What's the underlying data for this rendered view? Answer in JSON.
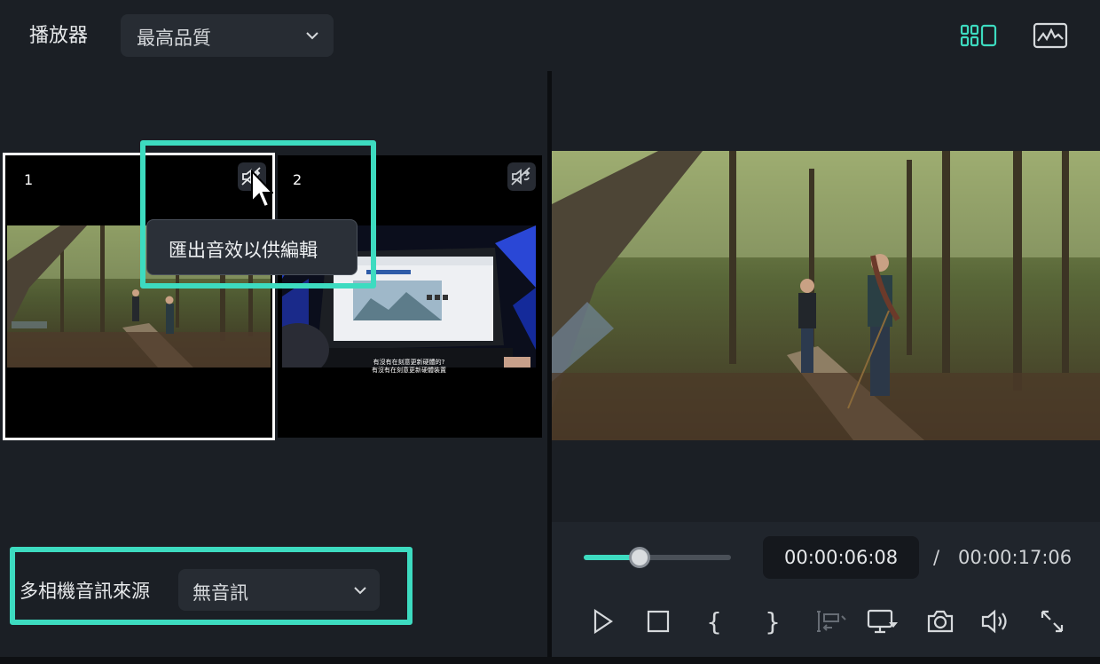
{
  "header": {
    "player_label": "播放器",
    "quality_value": "最高品質"
  },
  "cameras": [
    {
      "number": "1",
      "selected": true,
      "subtitle": []
    },
    {
      "number": "2",
      "selected": false,
      "subtitle": [
        "有沒有在刻意更新硬體的?",
        "有沒有在刻意更新硬體裝置"
      ]
    }
  ],
  "tooltip": {
    "text": "匯出音效以供編輯"
  },
  "audio_source": {
    "label": "多相機音訊來源",
    "value": "無音訊"
  },
  "playback": {
    "current_time": "00:00:06:08",
    "separator": "/",
    "total_time": "00:00:17:06",
    "progress": 0.38,
    "controls": {
      "brace_open": "{",
      "brace_close": "}"
    }
  },
  "colors": {
    "accent": "#3ddbc0",
    "panel": "#1b1f25",
    "control_bar": "#20252c"
  }
}
